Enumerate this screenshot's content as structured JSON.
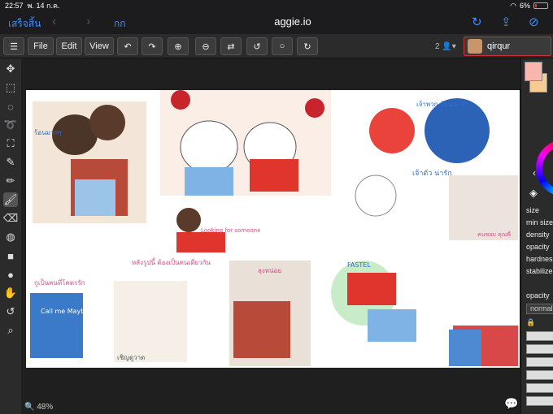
{
  "status_bar": {
    "time": "22:57",
    "date": "พ. 14 ก.ค.",
    "battery": "6%"
  },
  "browser": {
    "back_label": "เสร็จสิ้น",
    "text_size": "กก",
    "url": "aggie.io"
  },
  "toolbar": {
    "file": "File",
    "edit": "Edit",
    "view": "View",
    "user_count": "2",
    "username": "qirqur"
  },
  "tool_icons": [
    "move-icon",
    "select-rect-icon",
    "select-ellipse-icon",
    "lasso-icon",
    "transform-icon",
    "eyedropper-icon",
    "pencil-icon",
    "brush-icon",
    "eraser-icon",
    "fill-icon",
    "rectangle-icon",
    "ellipse-icon",
    "hand-icon",
    "rotate-icon",
    "zoom-icon"
  ],
  "status": {
    "zoom": "48%"
  },
  "colors": {
    "primary": "#f7b7ae",
    "secondary": "#f7cc92",
    "accent": "#3d8eff"
  },
  "brush_panel": {
    "size": "size",
    "min_size": "min size",
    "density": "density",
    "opacity": "opacity",
    "hardness": "hardness",
    "stabilizer": "stabilizer"
  },
  "layers_panel": {
    "opacity": "opacity",
    "blend_mode": "normal"
  },
  "canvas_texts": {
    "t1": "ร้อนมากๆ",
    "t2": "เจ้าพวก ก้อนน่ารัก",
    "t3": "Looking for someone",
    "t4": "หลังรูปนี้ ต้องเป็นคนเดียวกัน",
    "t5": "กูเป็นคนที่โคตรรัก",
    "t6": "Call me Maybe",
    "t7": "เจ้าตัว น่ารัก",
    "t8": "ลุงหน่อย",
    "t9": "FASTEL",
    "t10": "เชิญดูวาด",
    "t11": "คนชอบ คุณพี่"
  }
}
